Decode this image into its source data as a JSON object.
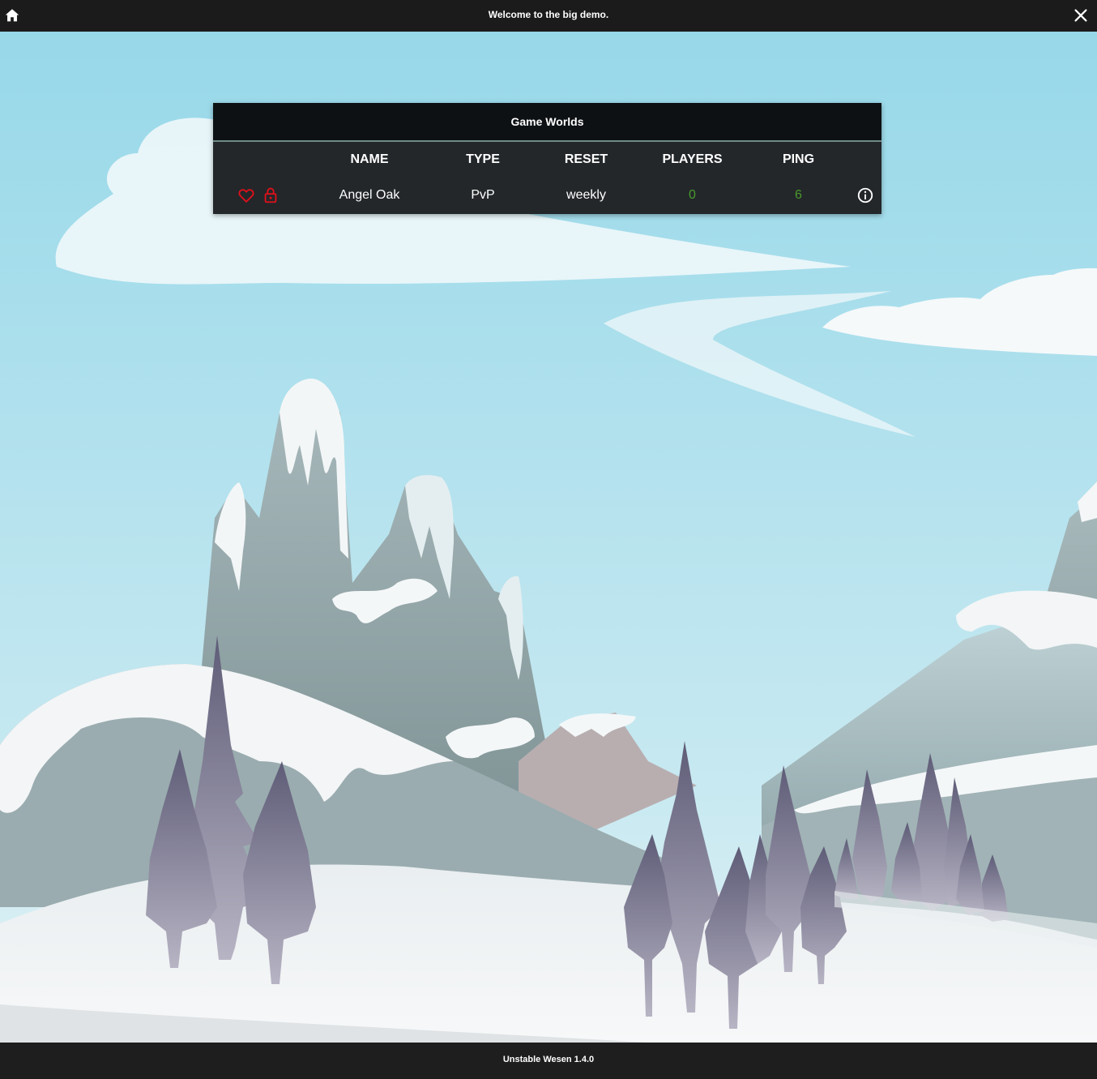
{
  "header": {
    "title": "Welcome to the big demo.",
    "home_icon": "home-icon",
    "close_icon": "close-icon"
  },
  "panel": {
    "title": "Game Worlds",
    "columns": [
      "NAME",
      "TYPE",
      "RESET",
      "PLAYERS",
      "PING"
    ],
    "rows": [
      {
        "favorite_icon": "heart-outline-icon",
        "lock_icon": "lock-open-icon",
        "name": "Angel Oak",
        "type": "PvP",
        "reset": "weekly",
        "players": "0",
        "ping": "6",
        "info_icon": "info-icon"
      }
    ]
  },
  "footer": {
    "version": "Unstable Wesen 1.4.0"
  },
  "colors": {
    "bar_bg": "#1b1b1b",
    "panel_bg": "#23272a",
    "panel_header_bg": "#0d1114",
    "accent_red": "#e0101a",
    "value_green": "#4a9a2c",
    "sky": "#9fd9ea"
  }
}
